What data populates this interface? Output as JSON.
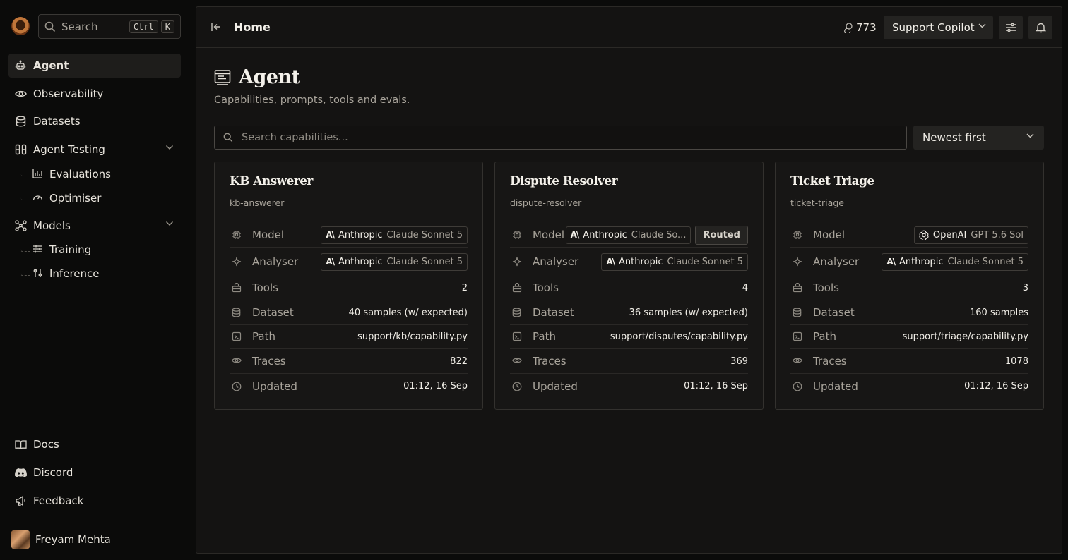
{
  "sidebar": {
    "search": {
      "label": "Search",
      "key1": "Ctrl",
      "key2": "K"
    },
    "nav": {
      "agent": "Agent",
      "observability": "Observability",
      "datasets": "Datasets",
      "agent_testing": "Agent Testing",
      "evaluations": "Evaluations",
      "optimiser": "Optimiser",
      "models": "Models",
      "training": "Training",
      "inference": "Inference"
    },
    "footer": {
      "docs": "Docs",
      "discord": "Discord",
      "feedback": "Feedback"
    },
    "user": {
      "name": "Freyam Mehta"
    }
  },
  "topbar": {
    "breadcrumb": "Home",
    "credits": "773",
    "project": "Support Copilot"
  },
  "page": {
    "title": "Agent",
    "subtitle": "Capabilities, prompts, tools and evals.",
    "search_placeholder": "Search capabilities...",
    "sort": "Newest first"
  },
  "labels": {
    "model": "Model",
    "analyser": "Analyser",
    "tools": "Tools",
    "dataset": "Dataset",
    "path": "Path",
    "traces": "Traces",
    "updated": "Updated",
    "routed": "Routed"
  },
  "cards": [
    {
      "title": "KB Answerer",
      "slug": "kb-answerer",
      "model_provider": "Anthropic",
      "model_name": "Claude Sonnet 5",
      "analyser_provider": "Anthropic",
      "analyser_name": "Claude Sonnet 5",
      "tools": "2",
      "dataset": "40 samples (w/ expected)",
      "path": "support/kb/capability.py",
      "traces": "822",
      "updated": "01:12, 16 Sep"
    },
    {
      "title": "Dispute Resolver",
      "slug": "dispute-resolver",
      "model_provider": "Anthropic",
      "model_name": "Claude So...",
      "analyser_provider": "Anthropic",
      "analyser_name": "Claude Sonnet 5",
      "tools": "4",
      "dataset": "36 samples (w/ expected)",
      "path": "support/disputes/capability.py",
      "traces": "369",
      "updated": "01:12, 16 Sep"
    },
    {
      "title": "Ticket Triage",
      "slug": "ticket-triage",
      "model_provider": "OpenAI",
      "model_name": "GPT 5.6 Sol",
      "analyser_provider": "Anthropic",
      "analyser_name": "Claude Sonnet 5",
      "tools": "3",
      "dataset": "160 samples",
      "path": "support/triage/capability.py",
      "traces": "1078",
      "updated": "01:12, 16 Sep"
    }
  ]
}
